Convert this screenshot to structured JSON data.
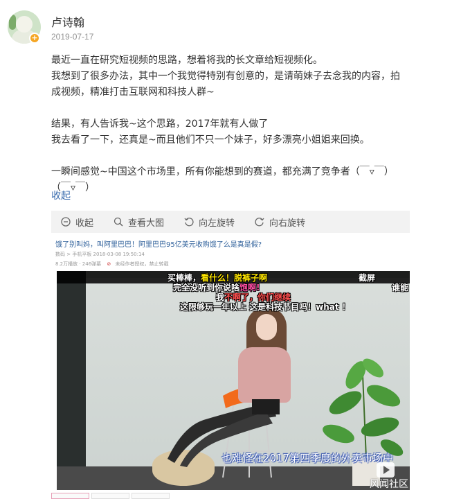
{
  "post": {
    "author": "卢诗翰",
    "date": "2019-07-17",
    "paragraphs": [
      "最近一直在研究短视频的思路，想着将我的长文章给短视频化。",
      "我想到了很多办法，其中一个我觉得特别有创意的，是请萌妹子去念我的内容，拍",
      "成视频，精准打击互联网和科技人群~",
      "",
      "结果，有人告诉我~这个思路，2017年就有人做了",
      "我去看了一下，还真是~而且他们不只一个妹子，好多漂亮小姐姐来回换。",
      "",
      "一瞬间感觉~中国这个市场里，所有你能想到的赛道，都充满了竞争者（￣▿￣）",
      "（￣▿￣）"
    ],
    "collapse_label": "收起"
  },
  "toolbar": {
    "items": [
      {
        "label": "收起",
        "icon": "collapse-icon"
      },
      {
        "label": "查看大图",
        "icon": "zoom-icon"
      },
      {
        "label": "向左旋转",
        "icon": "rotate-left-icon"
      },
      {
        "label": "向右旋转",
        "icon": "rotate-right-icon"
      }
    ]
  },
  "article": {
    "title": "饿了别叫妈，叫阿里巴巴！阿里巴巴95亿美元收购饿了么是真是假?",
    "meta": "数码 > 手机平板     2018-03-08 19:50:14",
    "views": "8.2万播放 · 246弹幕",
    "warning": "未经作者授权，禁止转载",
    "danmaku": [
      {
        "text": "买棒棒，",
        "color": "#ffffff"
      },
      {
        "text": "看什么！",
        "color": "#ffe600"
      },
      {
        "text": "脱裤子啊",
        "color": "#ffe600"
      },
      {
        "text": "截屏",
        "color": "#ffffff"
      },
      {
        "text": "完全没听到你说啥",
        "color": "#ffffff"
      },
      {
        "text": "饱啊!",
        "color": "#ff4fa3"
      },
      {
        "text": "谁能",
        "color": "#ffffff"
      },
      {
        "text": "我",
        "color": "#ffffff"
      },
      {
        "text": "不啊了，你们继续",
        "color": "#ffffff"
      },
      {
        "text": "这限够玩一年以上 这是科技节目吗！what ！",
        "color": "#ffffff"
      }
    ],
    "caption": "也难怪在2017第四季度的外卖市场中"
  },
  "watermark": "风闻社区"
}
